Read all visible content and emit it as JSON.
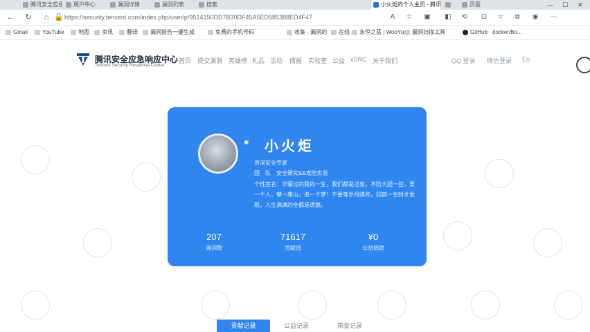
{
  "browser": {
    "tabs": [
      {
        "label": "腾讯安全应急...",
        "active": false
      },
      {
        "label": "用户中心",
        "active": false
      },
      {
        "label": "漏洞详情",
        "active": false
      },
      {
        "label": "漏洞列表",
        "active": false
      },
      {
        "label": "搜索",
        "active": false
      },
      {
        "label": "小火炬的个人主页 - 腾讯",
        "active": true
      },
      {
        "label": "",
        "active": false
      },
      {
        "label": "页面",
        "active": false
      }
    ],
    "url": "https://security.tencent.com/index.php/user/p/9514150DD7B30DF45A5ED585388ED4F47",
    "bookmarks": [
      "Gmail",
      "YouTube",
      "地图",
      "资讯",
      "翻译",
      "漏洞报告一键生成",
      "免费的手机号码",
      "收集 · 漏洞的报告",
      "在线",
      "永恒之蓝 | WooYun...",
      "漏洞扫描工具",
      "GitHub · ​docker/Bo..."
    ]
  },
  "site": {
    "brand_cn": "腾讯安全应急响应中心",
    "brand_en": "Tencent Security Response Center",
    "menu": [
      "首页",
      "提交漏洞",
      "英雄榜",
      "礼品",
      "活动",
      "情报",
      "实验室",
      "公益",
      "xSRC",
      "关于我们"
    ],
    "login": "QQ 登录",
    "wechat_login": "微信登录",
    "lang": "En"
  },
  "profile": {
    "name": "小火炬",
    "title": "资深安全专家",
    "team_label": "团　队",
    "team": "安全研究&&攻防实验",
    "signature": "个性签名：华丽过的我的一生，我们都是过客，不防大胆一些，爱一个人，攀一座山，追一个梦！不要等岁月蹉跎，回首一生时才发现，人生满满的全都是遗憾。",
    "stats": [
      {
        "value": "207",
        "label": "漏洞数"
      },
      {
        "value": "71617",
        "label": "贡献值"
      },
      {
        "value": "¥0",
        "label": "公益捐助"
      }
    ]
  },
  "bottom_tabs": [
    "贡献记录",
    "公益记录",
    "荣誉记录"
  ]
}
